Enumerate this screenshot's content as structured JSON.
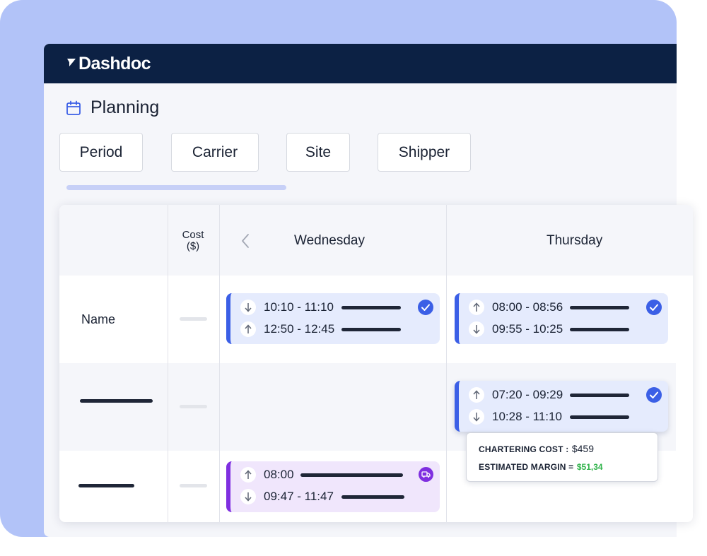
{
  "app": {
    "name": "Dashdoc",
    "brand_color": "#0c2144",
    "accent_color": "#3b5fe6"
  },
  "page": {
    "title": "Planning",
    "icon": "calendar-icon"
  },
  "filters": [
    {
      "label": "Period"
    },
    {
      "label": "Carrier"
    },
    {
      "label": "Site"
    },
    {
      "label": "Shipper"
    }
  ],
  "grid": {
    "cost_header": "Cost\n($)",
    "days": [
      {
        "label": "Wednesday"
      },
      {
        "label": "Thursday"
      }
    ],
    "rows": [
      {
        "label": "Name"
      }
    ],
    "slots": {
      "wed_row1": {
        "status": "check-icon",
        "lines": [
          {
            "direction": "down",
            "time": "10:10 - 11:10"
          },
          {
            "direction": "up",
            "time": "12:50 - 12:45"
          }
        ]
      },
      "thu_row1": {
        "status": "check-icon",
        "lines": [
          {
            "direction": "up",
            "time": "08:00 - 08:56"
          },
          {
            "direction": "down",
            "time": "09:55 - 10:25"
          }
        ]
      },
      "thu_row2": {
        "status": "check-icon",
        "lines": [
          {
            "direction": "up",
            "time": "07:20 - 09:29"
          },
          {
            "direction": "down",
            "time": "10:28 - 11:10"
          }
        ]
      },
      "wed_row3": {
        "status": "truck-icon",
        "color": "#7f2fe0",
        "lines": [
          {
            "direction": "up",
            "time": "08:00"
          },
          {
            "direction": "down",
            "time": "09:47 - 11:47"
          }
        ]
      }
    }
  },
  "tooltip": {
    "chartering_label": "CHARTERING COST :",
    "chartering_value": "$459",
    "margin_label": "ESTIMATED MARGIN =",
    "margin_value": "$51,34",
    "margin_color": "#2fb34a"
  }
}
